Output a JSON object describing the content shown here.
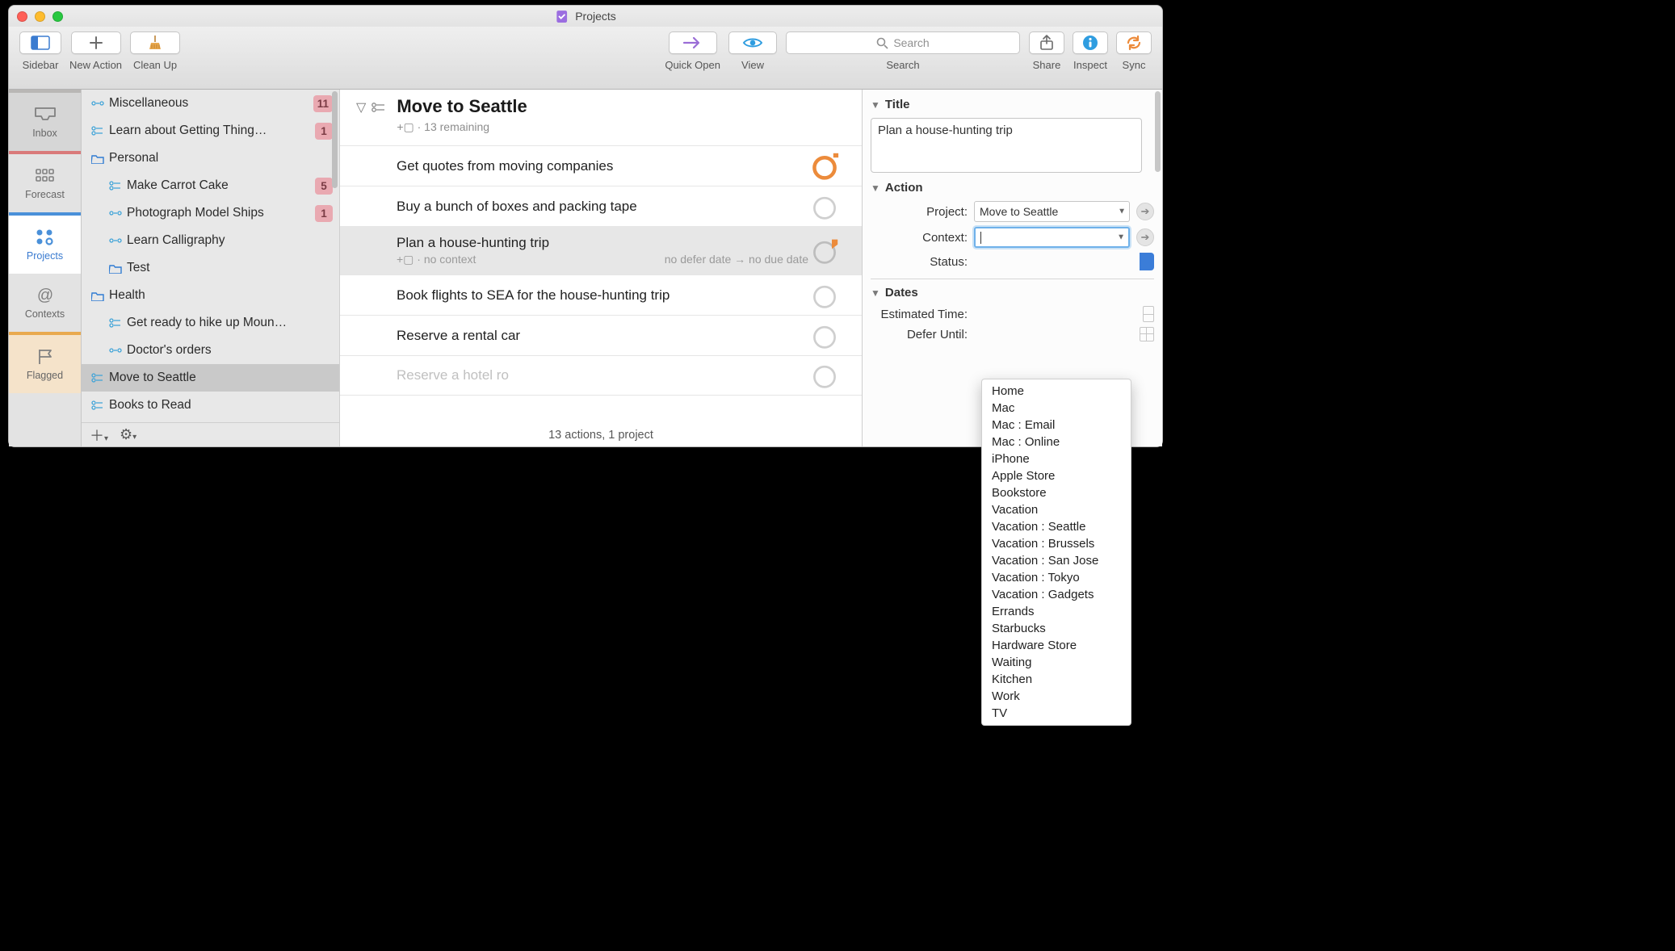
{
  "window": {
    "title": "Projects"
  },
  "toolbar": {
    "sidebar": "Sidebar",
    "new_action": "New Action",
    "clean_up": "Clean Up",
    "quick_open": "Quick Open",
    "view": "View",
    "search_placeholder": "Search",
    "search_label": "Search",
    "share": "Share",
    "inspect": "Inspect",
    "sync": "Sync"
  },
  "sidetabs": {
    "inbox": "Inbox",
    "forecast": "Forecast",
    "projects": "Projects",
    "contexts": "Contexts",
    "flagged": "Flagged"
  },
  "projects": {
    "items": [
      {
        "kind": "seq",
        "depth": 0,
        "label": "Miscellaneous",
        "badge": "11"
      },
      {
        "kind": "par",
        "depth": 0,
        "label": "Learn about Getting Thing…",
        "badge": "1"
      },
      {
        "kind": "folder",
        "depth": 0,
        "label": "Personal"
      },
      {
        "kind": "par",
        "depth": 1,
        "label": "Make Carrot Cake",
        "badge": "5"
      },
      {
        "kind": "seq",
        "depth": 1,
        "label": "Photograph Model Ships",
        "badge": "1"
      },
      {
        "kind": "seq",
        "depth": 1,
        "label": "Learn Calligraphy"
      },
      {
        "kind": "folder",
        "depth": 1,
        "label": "Test"
      },
      {
        "kind": "folder",
        "depth": 0,
        "label": "Health"
      },
      {
        "kind": "par",
        "depth": 1,
        "label": "Get ready to hike up Moun…"
      },
      {
        "kind": "seq",
        "depth": 1,
        "label": "Doctor's orders"
      },
      {
        "kind": "par",
        "depth": 0,
        "label": "Move to Seattle",
        "selected": true
      },
      {
        "kind": "par",
        "depth": 0,
        "label": "Books to Read"
      }
    ]
  },
  "center": {
    "title": "Move to Seattle",
    "subtitle": "+▢ · 13 remaining",
    "tasks": [
      {
        "title": "Get quotes from moving companies",
        "status": "due",
        "flagged": true
      },
      {
        "title": "Buy a bunch of boxes and packing tape"
      },
      {
        "title": "Plan a house-hunting trip",
        "selected": true,
        "flagged": true,
        "meta_left": "+▢ · no context",
        "meta_right": "no defer date → no due date"
      },
      {
        "title": "Book flights to SEA for the house-hunting trip"
      },
      {
        "title": "Reserve a rental car"
      },
      {
        "title": "Reserve a hotel ro",
        "fade": true
      }
    ],
    "footer": "13 actions, 1 project"
  },
  "inspector": {
    "title_head": "Title",
    "title_value": "Plan a house-hunting trip",
    "action_head": "Action",
    "project_label": "Project:",
    "project_value": "Move to Seattle",
    "context_label": "Context:",
    "context_value": "",
    "status_label": "Status:",
    "dates_head": "Dates",
    "est_label": "Estimated Time:",
    "defer_label": "Defer Until:"
  },
  "context_menu": [
    "Home",
    "Mac",
    "Mac : Email",
    "Mac : Online",
    "iPhone",
    "Apple Store",
    "Bookstore",
    "Vacation",
    "Vacation : Seattle",
    "Vacation : Brussels",
    "Vacation : San Jose",
    "Vacation : Tokyo",
    "Vacation : Gadgets",
    "Errands",
    "Starbucks",
    "Hardware Store",
    "Waiting",
    "Kitchen",
    "Work",
    "TV"
  ]
}
